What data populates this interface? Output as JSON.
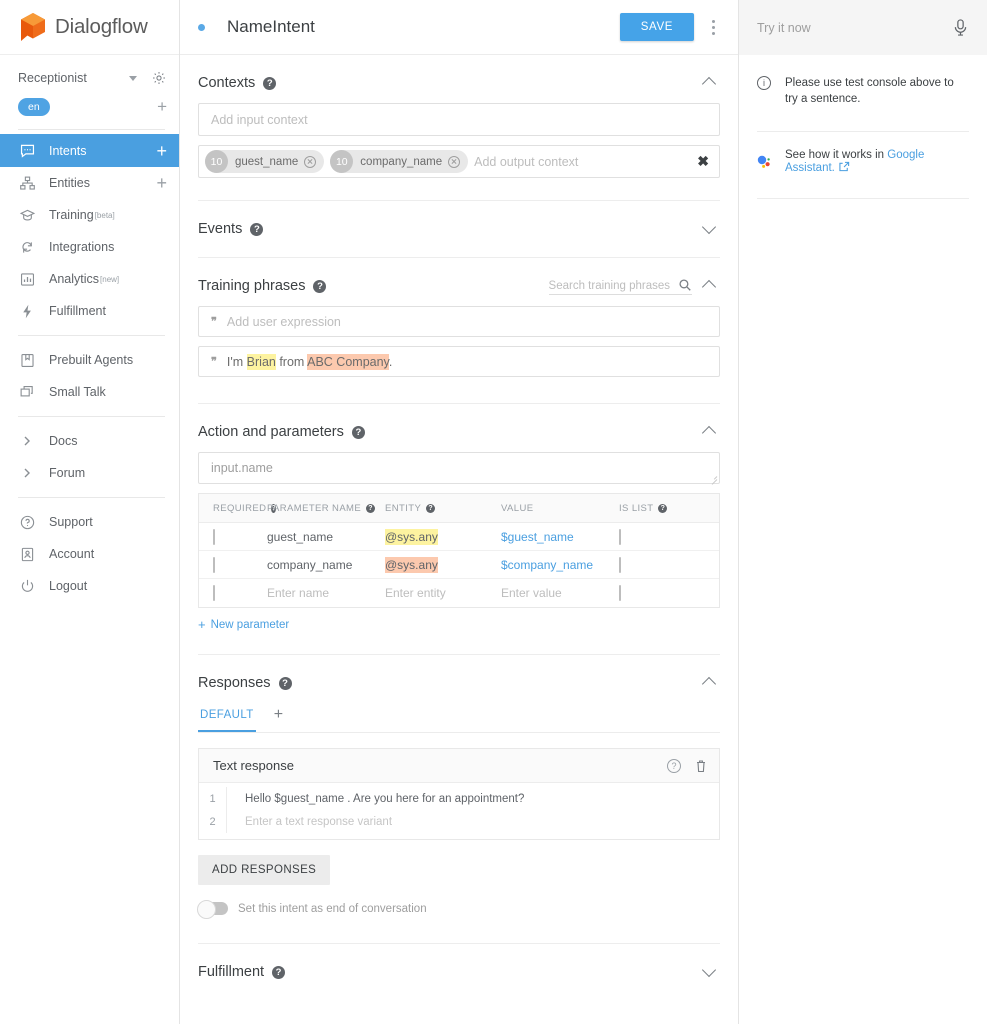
{
  "brand": {
    "name": "Dialogflow",
    "logo_icon": "dialogflow-cube-logo"
  },
  "sidebar": {
    "agent_name": "Receptionist",
    "settings_icon": "gear-icon",
    "agent_dropdown_icon": "chevron-down-icon",
    "language_chip": "en",
    "add_language_label": "+",
    "items": [
      {
        "label": "Intents",
        "icon": "intents-icon",
        "active": true,
        "trailing": "+"
      },
      {
        "label": "Entities",
        "icon": "entities-icon",
        "active": false,
        "trailing": "+"
      },
      {
        "label": "Training",
        "sup": "[beta]",
        "icon": "training-icon",
        "active": false
      },
      {
        "label": "Integrations",
        "icon": "integrations-icon",
        "active": false
      },
      {
        "label": "Analytics",
        "sup": "[new]",
        "icon": "analytics-icon",
        "active": false
      },
      {
        "label": "Fulfillment",
        "icon": "fulfillment-icon",
        "active": false
      }
    ],
    "items2": [
      {
        "label": "Prebuilt Agents",
        "icon": "prebuilt-agents-icon"
      },
      {
        "label": "Small Talk",
        "icon": "small-talk-icon"
      }
    ],
    "items3": [
      {
        "label": "Docs",
        "icon": "chevron-right-icon"
      },
      {
        "label": "Forum",
        "icon": "chevron-right-icon"
      }
    ],
    "items4": [
      {
        "label": "Support",
        "icon": "help-circle-icon"
      },
      {
        "label": "Account",
        "icon": "account-icon"
      },
      {
        "label": "Logout",
        "icon": "power-icon"
      }
    ]
  },
  "header": {
    "status_dot": "intent-status-dot",
    "intent_name": "NameIntent",
    "save_label": "SAVE",
    "menu_icon": "kebab-menu-icon"
  },
  "contexts": {
    "title": "Contexts",
    "help_icon": "help-icon",
    "collapse_icon": "chevron-up-icon",
    "input_placeholder": "Add input context",
    "output_placeholder": "Add output context",
    "clear_icon": "close-icon",
    "output_chips": [
      {
        "lifespan": "10",
        "name": "guest_name",
        "remove_icon": "remove-chip-icon"
      },
      {
        "lifespan": "10",
        "name": "company_name",
        "remove_icon": "remove-chip-icon"
      }
    ]
  },
  "events": {
    "title": "Events",
    "help_icon": "help-icon",
    "expand_icon": "chevron-down-icon"
  },
  "training_phrases": {
    "title": "Training phrases",
    "help_icon": "help-icon",
    "search_placeholder": "Search training phrases",
    "search_icon": "search-icon",
    "collapse_icon": "chevron-up-icon",
    "add_placeholder": "Add user expression",
    "phrase": {
      "pre": "I'm ",
      "entity1": "Brian",
      "mid": " from ",
      "entity2": "ABC Company",
      "post": "."
    }
  },
  "action": {
    "title": "Action and parameters",
    "help_icon": "help-icon",
    "collapse_icon": "chevron-up-icon",
    "action_name": "input.name",
    "columns": {
      "required": "REQUIRED",
      "parameter_name": "PARAMETER NAME",
      "entity": "ENTITY",
      "value": "VALUE",
      "is_list": "IS LIST"
    },
    "rows": [
      {
        "name": "guest_name",
        "entity": "@sys.any",
        "value": "$guest_name",
        "highlight": "yellow",
        "required": false,
        "is_list": false
      },
      {
        "name": "company_name",
        "entity": "@sys.any",
        "value": "$company_name",
        "highlight": "orange",
        "required": false,
        "is_list": false
      }
    ],
    "empty_row": {
      "name": "Enter name",
      "entity": "Enter entity",
      "value": "Enter value"
    },
    "new_parameter_label": "New parameter"
  },
  "responses": {
    "title": "Responses",
    "help_icon": "help-icon",
    "collapse_icon": "chevron-up-icon",
    "tab_default": "DEFAULT",
    "tab_add": "+",
    "card_title": "Text response",
    "card_help_icon": "help-circle-icon",
    "card_delete_icon": "trash-icon",
    "rows": [
      {
        "num": "1",
        "text": "Hello $guest_name . Are you here for an appointment?",
        "placeholder": false
      },
      {
        "num": "2",
        "text": "Enter a text response variant",
        "placeholder": true
      }
    ],
    "add_responses_label": "ADD RESPONSES",
    "end_of_conversation_label": "Set this intent as end of conversation",
    "end_of_conversation_on": false
  },
  "fulfillment": {
    "title": "Fulfillment",
    "help_icon": "help-icon",
    "expand_icon": "chevron-down-icon"
  },
  "right_panel": {
    "try_placeholder": "Try it now",
    "mic_icon": "microphone-icon",
    "info_icon": "info-icon",
    "note": "Please use test console above to try a sentence.",
    "assistant_icon": "google-assistant-icon",
    "assistant_prefix": "See how it works in ",
    "assistant_link": "Google Assistant.",
    "external_icon": "external-link-icon"
  },
  "colors": {
    "accent_blue": "#4a9fe0",
    "brand_orange": "#ef6c1a",
    "highlight_yellow": "#fdf3a0",
    "highlight_orange": "#fcc9ae",
    "text_primary": "#3c4043",
    "text_muted": "#9aa0a6"
  }
}
